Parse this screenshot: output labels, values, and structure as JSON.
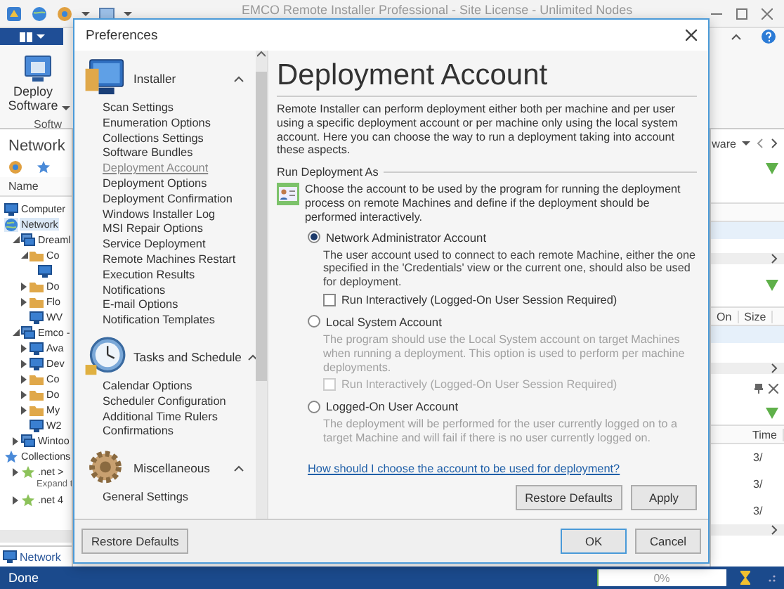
{
  "app": {
    "title": "EMCO Remote Installer Professional - Site License - Unlimited Nodes"
  },
  "ribbon": {
    "deploy_button": "Deploy Software",
    "group_label": "Softw"
  },
  "network_panel": {
    "title": "Network",
    "column": "Name",
    "tree": [
      {
        "label": "Computer",
        "kind": "computer",
        "selected": false
      },
      {
        "label": "Network",
        "kind": "network",
        "selected": true,
        "children": [
          {
            "label": "Dreaml",
            "kind": "domain",
            "expanded": true,
            "selected": false,
            "children": [
              {
                "label": "Co",
                "kind": "folder",
                "expanded": true,
                "selected": false,
                "children": [
                  {
                    "kind": "computer",
                    "selected": false
                  }
                ]
              },
              {
                "label": "Do",
                "kind": "folder",
                "expanded": false,
                "selected": false
              },
              {
                "label": "Flo",
                "kind": "folder",
                "expanded": false,
                "selected": false
              },
              {
                "label": "WV",
                "kind": "computer",
                "selected": false
              }
            ]
          },
          {
            "label": "Emco -",
            "kind": "domain",
            "expanded": true,
            "selected": false,
            "children": [
              {
                "label": "Ava",
                "kind": "computer",
                "expanded": false,
                "selected": false
              },
              {
                "label": "Dev",
                "kind": "computer",
                "expanded": false,
                "selected": false
              },
              {
                "label": "Co",
                "kind": "folder",
                "expanded": false,
                "selected": false
              },
              {
                "label": "Do",
                "kind": "folder",
                "expanded": false,
                "selected": false
              },
              {
                "label": "My",
                "kind": "folder",
                "expanded": false,
                "selected": false
              },
              {
                "label": "W2",
                "kind": "computer",
                "selected": false
              }
            ]
          },
          {
            "label": "Wintoo",
            "kind": "domain",
            "expanded": false,
            "selected": false
          }
        ]
      },
      {
        "label": "Collections",
        "kind": "star",
        "selected": false,
        "children": [
          {
            "label": ".net >",
            "kind": "collection",
            "expanded": false,
            "selected": false,
            "note": "Expand t"
          },
          {
            "label": ".net 4",
            "kind": "collection",
            "expanded": false,
            "selected": false
          }
        ]
      }
    ],
    "bottom_tab": "Network"
  },
  "right_panels": {
    "header": "ware",
    "columns_1": [
      "On",
      "Size"
    ],
    "columns_2": [
      "Time"
    ],
    "rows_2": [
      "3/",
      "3/",
      "3/"
    ]
  },
  "status_bar": {
    "text": "Done",
    "progress_text": "0%",
    "level": 0
  },
  "dialog": {
    "title": "Preferences",
    "nav": [
      {
        "title": "Installer",
        "kind": "installer",
        "expanded": true,
        "items": [
          {
            "label": "Scan Settings",
            "selected": false
          },
          {
            "label": "Enumeration Options",
            "selected": false
          },
          {
            "label": "Collections Settings",
            "selected": false
          },
          {
            "label": "Software Bundles",
            "selected": false
          },
          {
            "label": "Deployment Account",
            "selected": true
          },
          {
            "label": "Deployment Options",
            "selected": false
          },
          {
            "label": "Deployment Confirmation",
            "selected": false
          },
          {
            "label": "Windows Installer Log",
            "selected": false
          },
          {
            "label": "MSI Repair Options",
            "selected": false
          },
          {
            "label": "Service Deployment",
            "selected": false
          },
          {
            "label": "Remote Machines Restart",
            "selected": false
          },
          {
            "label": "Execution Results",
            "selected": false
          },
          {
            "label": "Notifications",
            "selected": false
          },
          {
            "label": "E-mail Options",
            "selected": false
          },
          {
            "label": "Notification Templates",
            "selected": false
          }
        ]
      },
      {
        "title": "Tasks and Schedule",
        "kind": "clock",
        "expanded": true,
        "items": [
          {
            "label": "Calendar Options",
            "selected": false
          },
          {
            "label": "Scheduler Configuration",
            "selected": false
          },
          {
            "label": "Additional Time Rulers",
            "selected": false
          },
          {
            "label": "Confirmations",
            "selected": false
          }
        ]
      },
      {
        "title": "Miscellaneous",
        "kind": "gear",
        "expanded": true,
        "items": [
          {
            "label": "General Settings",
            "selected": false
          }
        ]
      }
    ],
    "page": {
      "heading": "Deployment Account",
      "description": "Remote Installer can perform deployment either both per machine and per user using a specific deployment account or per machine only using the local system account. Here you can choose the way to run a deployment taking into account these aspects.",
      "section": "Run Deployment As",
      "intro": "Choose the account to be used by the program for running the deployment process on remote Machines and define if the deployment should be performed interactively.",
      "options": [
        {
          "label": "Network Administrator Account",
          "selected": true,
          "description": "The user account used to connect to each remote Machine, either the one specified in the 'Credentials' view or the current one, should also be used for deployment.",
          "checkbox": {
            "label": "Run Interactively (Logged-On User Session Required)",
            "checked": false,
            "disabled": false
          }
        },
        {
          "label": "Local System Account",
          "selected": false,
          "description": "The program should use the Local System account on target Machines when running a deployment. This option is used to perform per machine deployments.",
          "checkbox": {
            "label": "Run Interactively (Logged-On User Session Required)",
            "checked": false,
            "disabled": true
          }
        },
        {
          "label": "Logged-On User Account",
          "selected": false,
          "description": "The deployment will be performed for the user currently logged on to a target Machine and will fail if there is no user currently logged on."
        }
      ],
      "link": "How should I choose the account to be used for deployment?",
      "buttons": [
        "Restore Defaults",
        "Apply"
      ]
    },
    "footer_buttons": [
      {
        "label": "Restore Defaults",
        "kind": "plain"
      },
      {
        "label": "OK",
        "kind": "default"
      },
      {
        "label": "Cancel",
        "kind": "plain"
      }
    ]
  }
}
